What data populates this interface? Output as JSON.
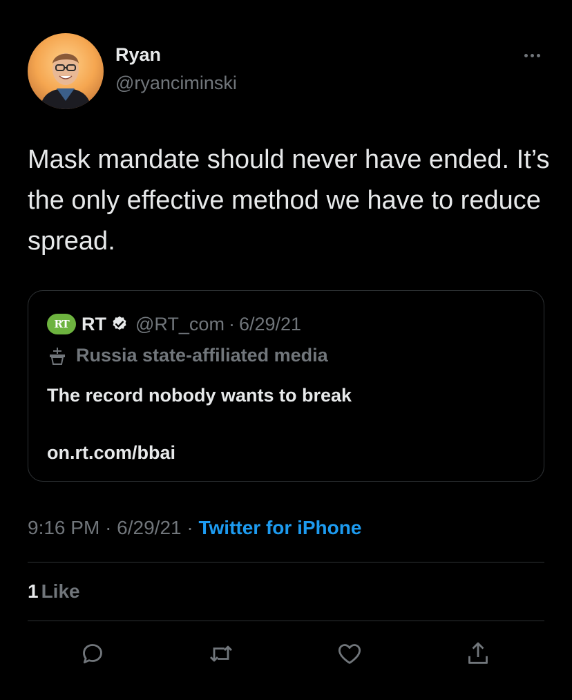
{
  "author": {
    "name": "Ryan",
    "handle": "@ryanciminski"
  },
  "tweet": {
    "text": "Mask mandate should never have ended. It’s the only effective method we have to reduce spread."
  },
  "quoted_tweet": {
    "logo_text": "RT",
    "name": "RT",
    "handle": "@RT_com",
    "separator": "·",
    "date": "6/29/21",
    "label": "Russia state-affiliated media",
    "text": "The record nobody wants to break",
    "link": "on.rt.com/bbai"
  },
  "meta": {
    "time": "9:16 PM",
    "separator": "·",
    "date": "6/29/21",
    "source": "Twitter for iPhone"
  },
  "likes": {
    "count": "1",
    "label": "Like"
  },
  "actions": {
    "icons": [
      "reply-icon",
      "retweet-icon",
      "like-icon",
      "share-icon"
    ]
  },
  "colors": {
    "background": "#000000",
    "text": "#e7e9ea",
    "muted": "#71767b",
    "accent": "#1d9bf0",
    "border": "#2f3336",
    "rt_logo": "#6db33f"
  }
}
